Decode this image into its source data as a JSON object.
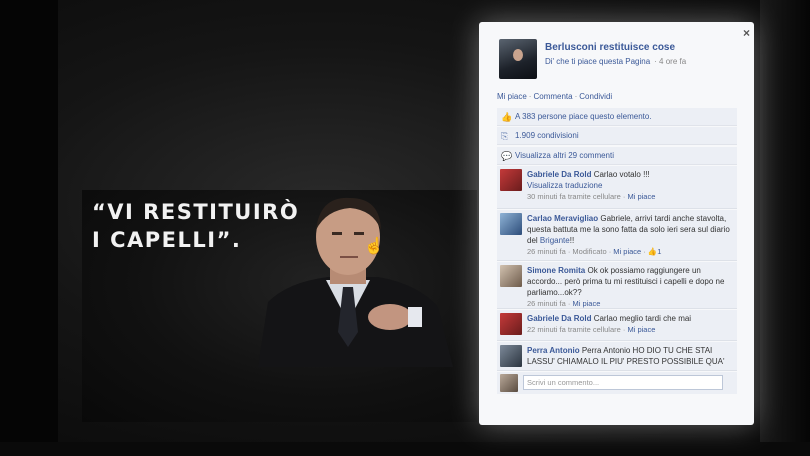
{
  "quote": {
    "line1": "“VI RESTITUIRÒ",
    "line2": "I CAPELLI”."
  },
  "fb": {
    "close_label": "×",
    "page_name": "Berlusconi restituisce cose",
    "like_page": "Di' che ti piace questa Pagina",
    "time": "· 4 ore fa",
    "actions": [
      "Mi piace",
      "Commenta",
      "Condividi"
    ],
    "likes_text": "A 383 persone piace questo elemento.",
    "shares_text": "1.909 condivisioni",
    "more_comments": "Visualizza altri 29 commenti",
    "comments": [
      {
        "name": "Gabriele Da Rold",
        "text": "Carlao votalo !!!",
        "extra_link": "Visualizza traduzione",
        "meta": "30 minuti fa tramite cellulare",
        "meta_link": "Mi piace"
      },
      {
        "name": "Carlao Meravigliao",
        "text": "Gabriele, arrivi tardi anche stavolta, questa battuta me la sono fatta da solo ieri sera sul diario del",
        "mention": "Brigante",
        "text_end": "!!",
        "meta": "26 minuti fa · Modificato ·",
        "meta_link": "Mi piace",
        "likes": "1"
      },
      {
        "name": "Simone Romita",
        "text": "Ok ok possiamo raggiungere un accordo... però prima tu mi restituisci i capelli e dopo ne parliamo...ok??",
        "meta": "26 minuti fa ·",
        "meta_link": "Mi piace"
      },
      {
        "name": "Gabriele Da Rold",
        "text": "Carlao meglio tardi che mai",
        "meta": "22 minuti fa tramite cellulare ·",
        "meta_link": "Mi piace"
      },
      {
        "name": "Perra Antonio",
        "text": "Perra Antonio HO DIO TU CHE STAI LASSU' CHIAMALO IL PIU' PRESTO POSSIBILE QUA'"
      }
    ],
    "write_placeholder": "Scrivi un commento..."
  },
  "colors": {
    "fb_link": "#3b5998",
    "fb_panel": "#eceff5"
  },
  "icons": [
    "close-icon",
    "thumbs-up-icon",
    "share-icon",
    "comment-icon",
    "cursor-hand-icon"
  ]
}
